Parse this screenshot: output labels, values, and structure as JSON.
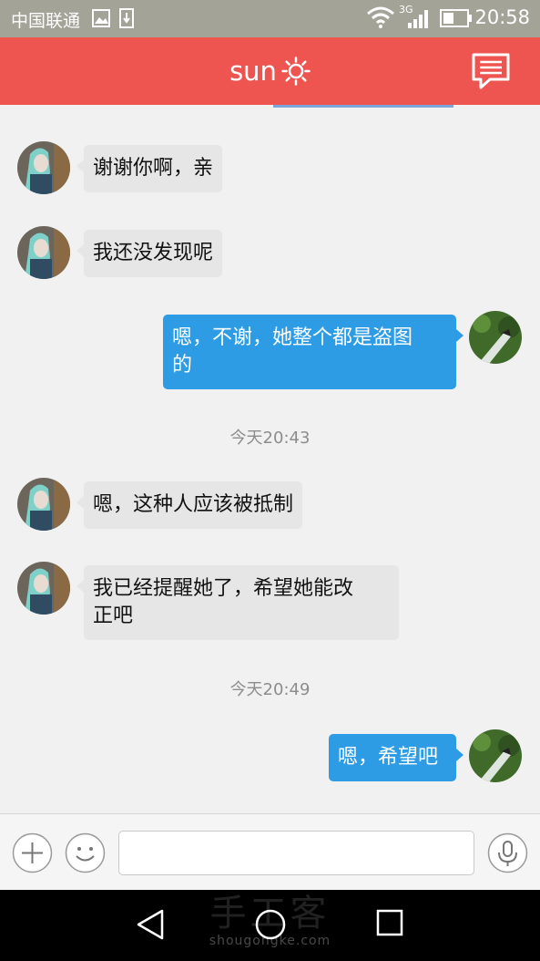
{
  "status_bar": {
    "carrier": "中国联通",
    "network_label": "3G",
    "time": "20:58"
  },
  "header": {
    "title": "sun",
    "title_icon": "sun-icon",
    "action_icon": "chat-bubble-icon",
    "color": "#ee5450"
  },
  "messages": [
    {
      "from": "other",
      "text": "谢谢你啊，亲"
    },
    {
      "from": "other",
      "text": "我还没发现呢"
    },
    {
      "from": "me",
      "lines": [
        "嗯，不谢，她整个都是盗图",
        "的"
      ]
    },
    {
      "timestamp": "今天20:43"
    },
    {
      "from": "other",
      "text": "嗯，这种人应该被抵制"
    },
    {
      "from": "other",
      "lines": [
        "我已经提醒她了，希望她能改",
        "正吧"
      ]
    },
    {
      "timestamp": "今天20:49"
    },
    {
      "from": "me",
      "text": "嗯，希望吧"
    }
  ],
  "input_bar": {
    "plus_icon": "plus-icon",
    "emoji_icon": "emoji-icon",
    "text_value": "",
    "mic_icon": "microphone-icon"
  },
  "nav_bar": {
    "back_icon": "back-triangle-icon",
    "home_icon": "home-circle-icon",
    "recents_icon": "recents-square-icon"
  },
  "watermark": {
    "main": "手工客",
    "sub": "shougongke.com"
  },
  "colors": {
    "my_bubble": "#2e9ce5",
    "other_bubble": "#e6e6e6",
    "background": "#f1f1f1"
  }
}
